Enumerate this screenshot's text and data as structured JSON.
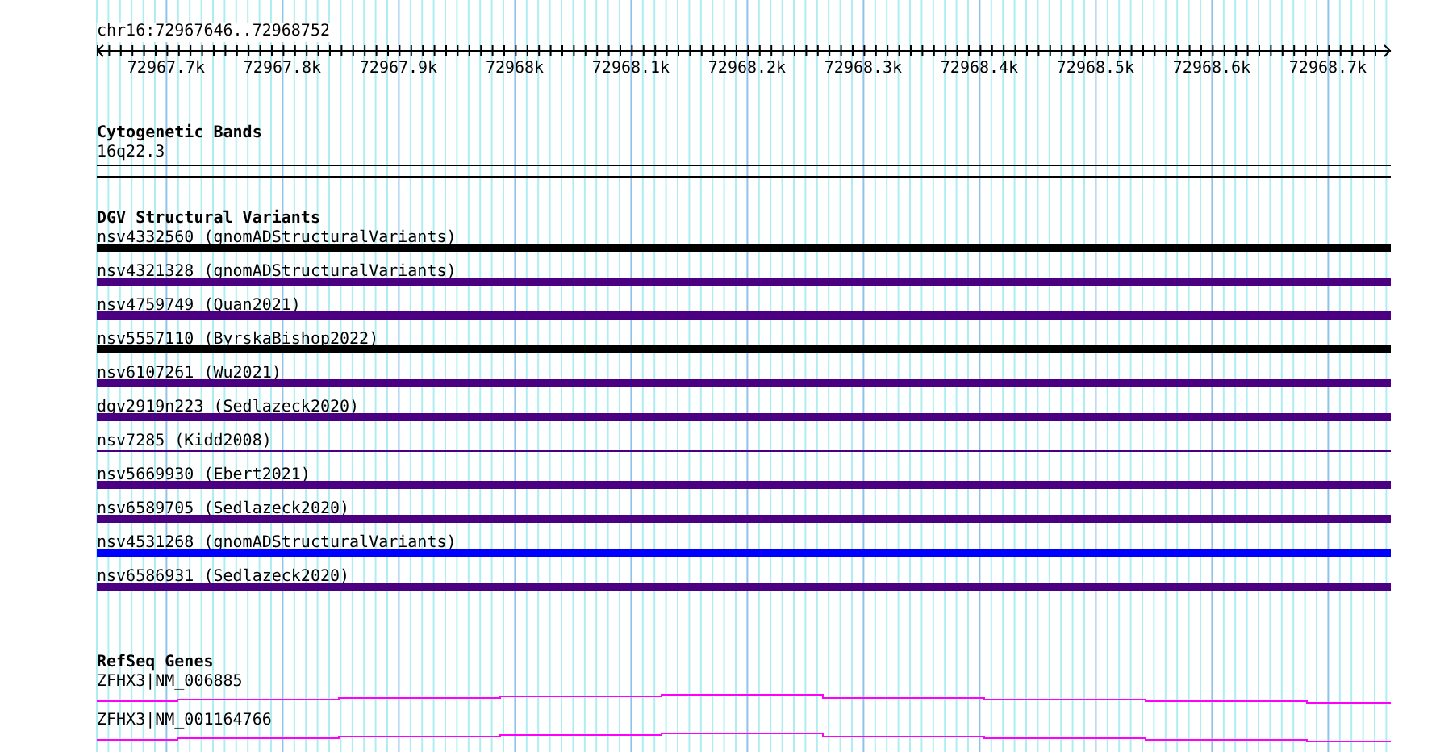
{
  "locus": "chr16:72967646..72968752",
  "ruler": {
    "labels": [
      "72967.7k",
      "72967.8k",
      "72967.9k",
      "72968k",
      "72968.1k",
      "72968.2k",
      "72968.3k",
      "72968.4k",
      "72968.5k",
      "72968.6k",
      "72968.7k"
    ]
  },
  "cytogenetic_bands": {
    "title": "Cytogenetic Bands",
    "band": "16q22.3"
  },
  "dgv": {
    "title": "DGV Structural Variants",
    "features": [
      {
        "label": "nsv4332560 (gnomADStructuralVariants)",
        "kind": "bar",
        "color": "#000000"
      },
      {
        "label": "nsv4321328 (gnomADStructuralVariants)",
        "kind": "bar",
        "color": "#4b0082"
      },
      {
        "label": "nsv4759749 (Quan2021)",
        "kind": "bar",
        "color": "#4b0082"
      },
      {
        "label": "nsv5557110 (ByrskaBishop2022)",
        "kind": "bar",
        "color": "#000000"
      },
      {
        "label": "nsv6107261 (Wu2021)",
        "kind": "bar",
        "color": "#4b0082"
      },
      {
        "label": "dgv2919n223 (Sedlazeck2020)",
        "kind": "bar",
        "color": "#4b0082"
      },
      {
        "label": "nsv7285 (Kidd2008)",
        "kind": "line",
        "color": "#4b0082"
      },
      {
        "label": "nsv5669930 (Ebert2021)",
        "kind": "bar",
        "color": "#4b0082"
      },
      {
        "label": "nsv6589705 (Sedlazeck2020)",
        "kind": "bar",
        "color": "#4b0082"
      },
      {
        "label": "nsv4531268 (gnomADStructuralVariants)",
        "kind": "bar",
        "color": "#0000ff"
      },
      {
        "label": "nsv6586931 (Sedlazeck2020)",
        "kind": "bar",
        "color": "#4b0082"
      }
    ]
  },
  "refseq": {
    "title": "RefSeq Genes",
    "genes": [
      {
        "label": "ZFHX3|NM_006885"
      },
      {
        "label": "ZFHX3|NM_001164766"
      }
    ]
  }
}
